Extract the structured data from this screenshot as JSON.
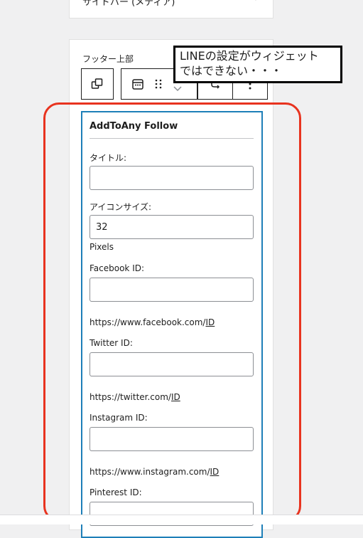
{
  "top_panel": {
    "title": "サイドバー (メディア)"
  },
  "footer_region": {
    "label": "フッター上部"
  },
  "callout": {
    "line1": "LINEの設定がウィジェット",
    "line2": "ではできない・・・"
  },
  "widget": {
    "title": "AddToAny Follow",
    "title_label": "タイトル:",
    "title_value": "",
    "icon_size_label": "アイコンサイズ:",
    "icon_size_value": "32",
    "icon_size_unit": "Pixels",
    "facebook_label": "Facebook ID:",
    "facebook_value": "",
    "facebook_url_prefix": "https://www.facebook.com/",
    "facebook_url_suffix": "ID",
    "twitter_label": "Twitter ID:",
    "twitter_value": "",
    "twitter_url_prefix": "https://twitter.com/",
    "twitter_url_suffix": "ID",
    "instagram_label": "Instagram ID:",
    "instagram_value": "",
    "instagram_url_prefix": "https://www.instagram.com/",
    "instagram_url_suffix": "ID",
    "pinterest_label": "Pinterest ID:",
    "pinterest_value": ""
  },
  "colors": {
    "widget_border": "#1e7fb8",
    "highlight": "#e8331f",
    "background": "#f0f0f1"
  },
  "icons": [
    "chevron-down-icon",
    "copy-blocks-icon",
    "calendar-icon",
    "drag-handle-icon",
    "chevron-down-icon",
    "transform-icon",
    "more-options-icon"
  ]
}
